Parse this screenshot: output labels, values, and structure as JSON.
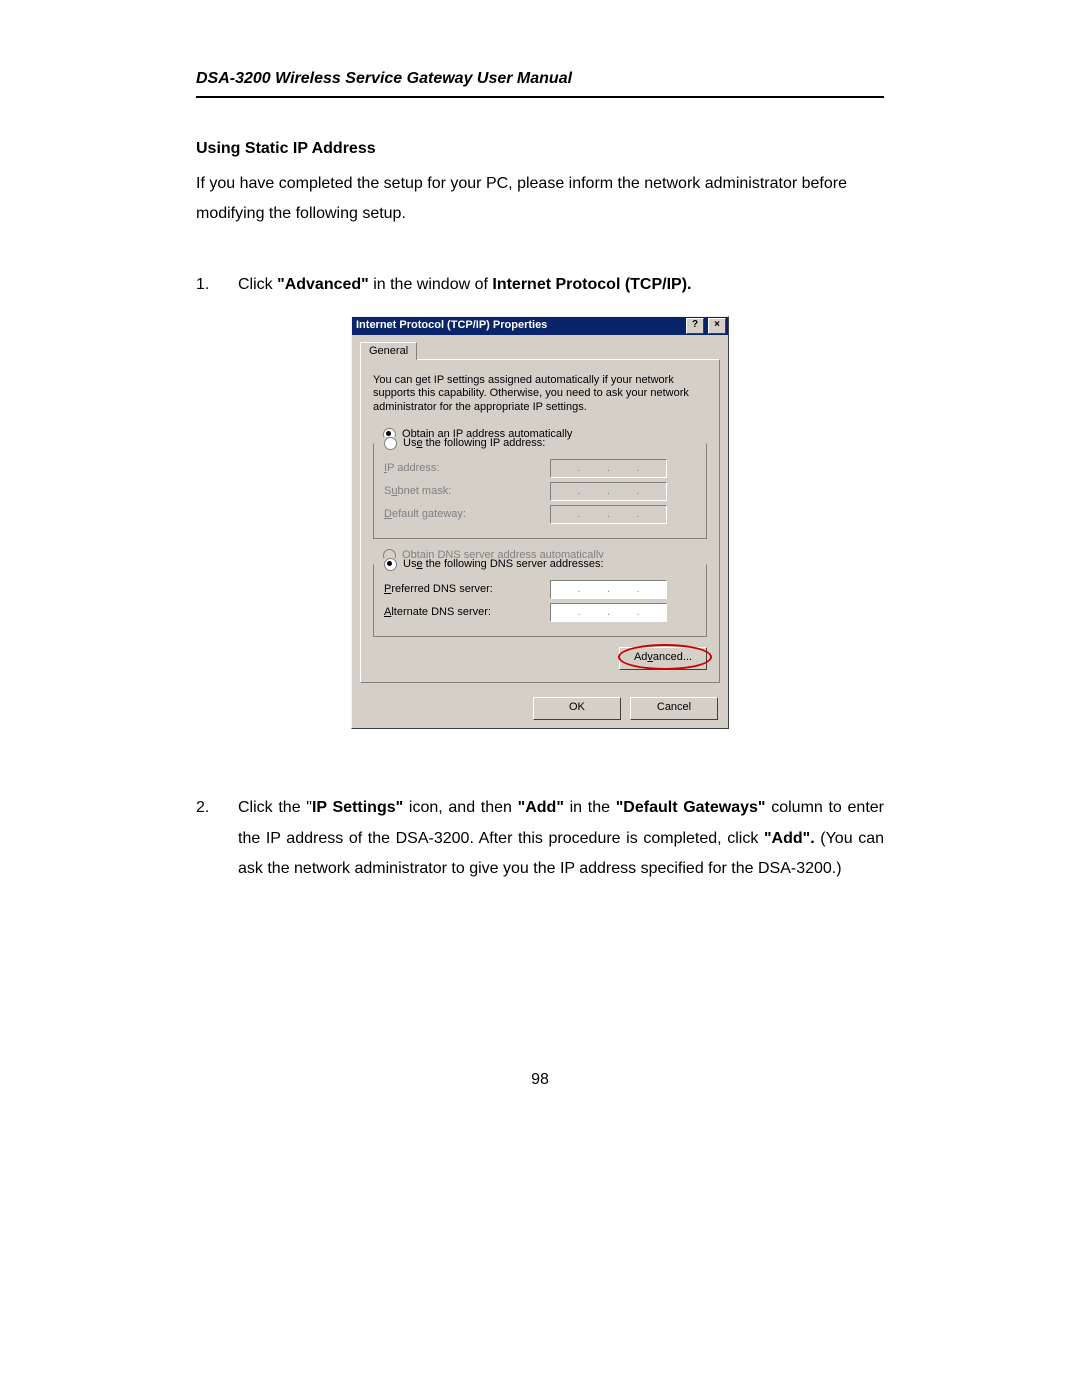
{
  "doc": {
    "header": "DSA-3200 Wireless Service Gateway User Manual",
    "section_title": "Using Static IP Address",
    "intro": "If you have completed the setup for your PC, please inform the network administrator before modifying the following setup.",
    "page_number": "98"
  },
  "step1": {
    "num": "1.",
    "pre": "Click ",
    "b1": "\"Advanced\"",
    "mid": " in the window of ",
    "b2": "Internet Protocol (TCP/IP)."
  },
  "step2": {
    "num": "2.",
    "t1": "Click the \"",
    "b1": "IP Settings\"",
    "t2": " icon, and then ",
    "b2": "\"Add\"",
    "t3": " in the ",
    "b3": "\"Default Gateways\"",
    "t4": " column to enter the IP address of the DSA-3200.    After this procedure is completed, click ",
    "b4": "\"Add\".",
    "t5": "   (You can ask the network administrator to give you the IP address specified for the DSA-3200.)"
  },
  "dlg": {
    "title": "Internet Protocol (TCP/IP) Properties",
    "help_btn": "?",
    "close_btn": "×",
    "tab_general": "General",
    "info": "You can get IP settings assigned automatically if your network supports this capability. Otherwise, you need to ask your network administrator for the appropriate IP settings.",
    "r_obtain_ip_pre": "O",
    "r_obtain_ip": "btain an IP address automatically",
    "r_use_ip_pre": "Us",
    "r_use_ip_u": "e",
    "r_use_ip_post": " the following IP address:",
    "f_ip": "IP address:",
    "f_subnet": "Subnet mask:",
    "f_gateway": "Default gateway:",
    "r_obtain_dns_pre": "O",
    "r_obtain_dns_u": "b",
    "r_obtain_dns_post": "tain DNS server address automatically",
    "r_use_dns_pre": "Us",
    "r_use_dns_u": "e",
    "r_use_dns_post": " the following DNS server addresses:",
    "f_pref_dns": "Preferred DNS server:",
    "f_alt_dns": "Alternate DNS server:",
    "btn_advanced": "Advanced...",
    "btn_ok": "OK",
    "btn_cancel": "Cancel"
  }
}
